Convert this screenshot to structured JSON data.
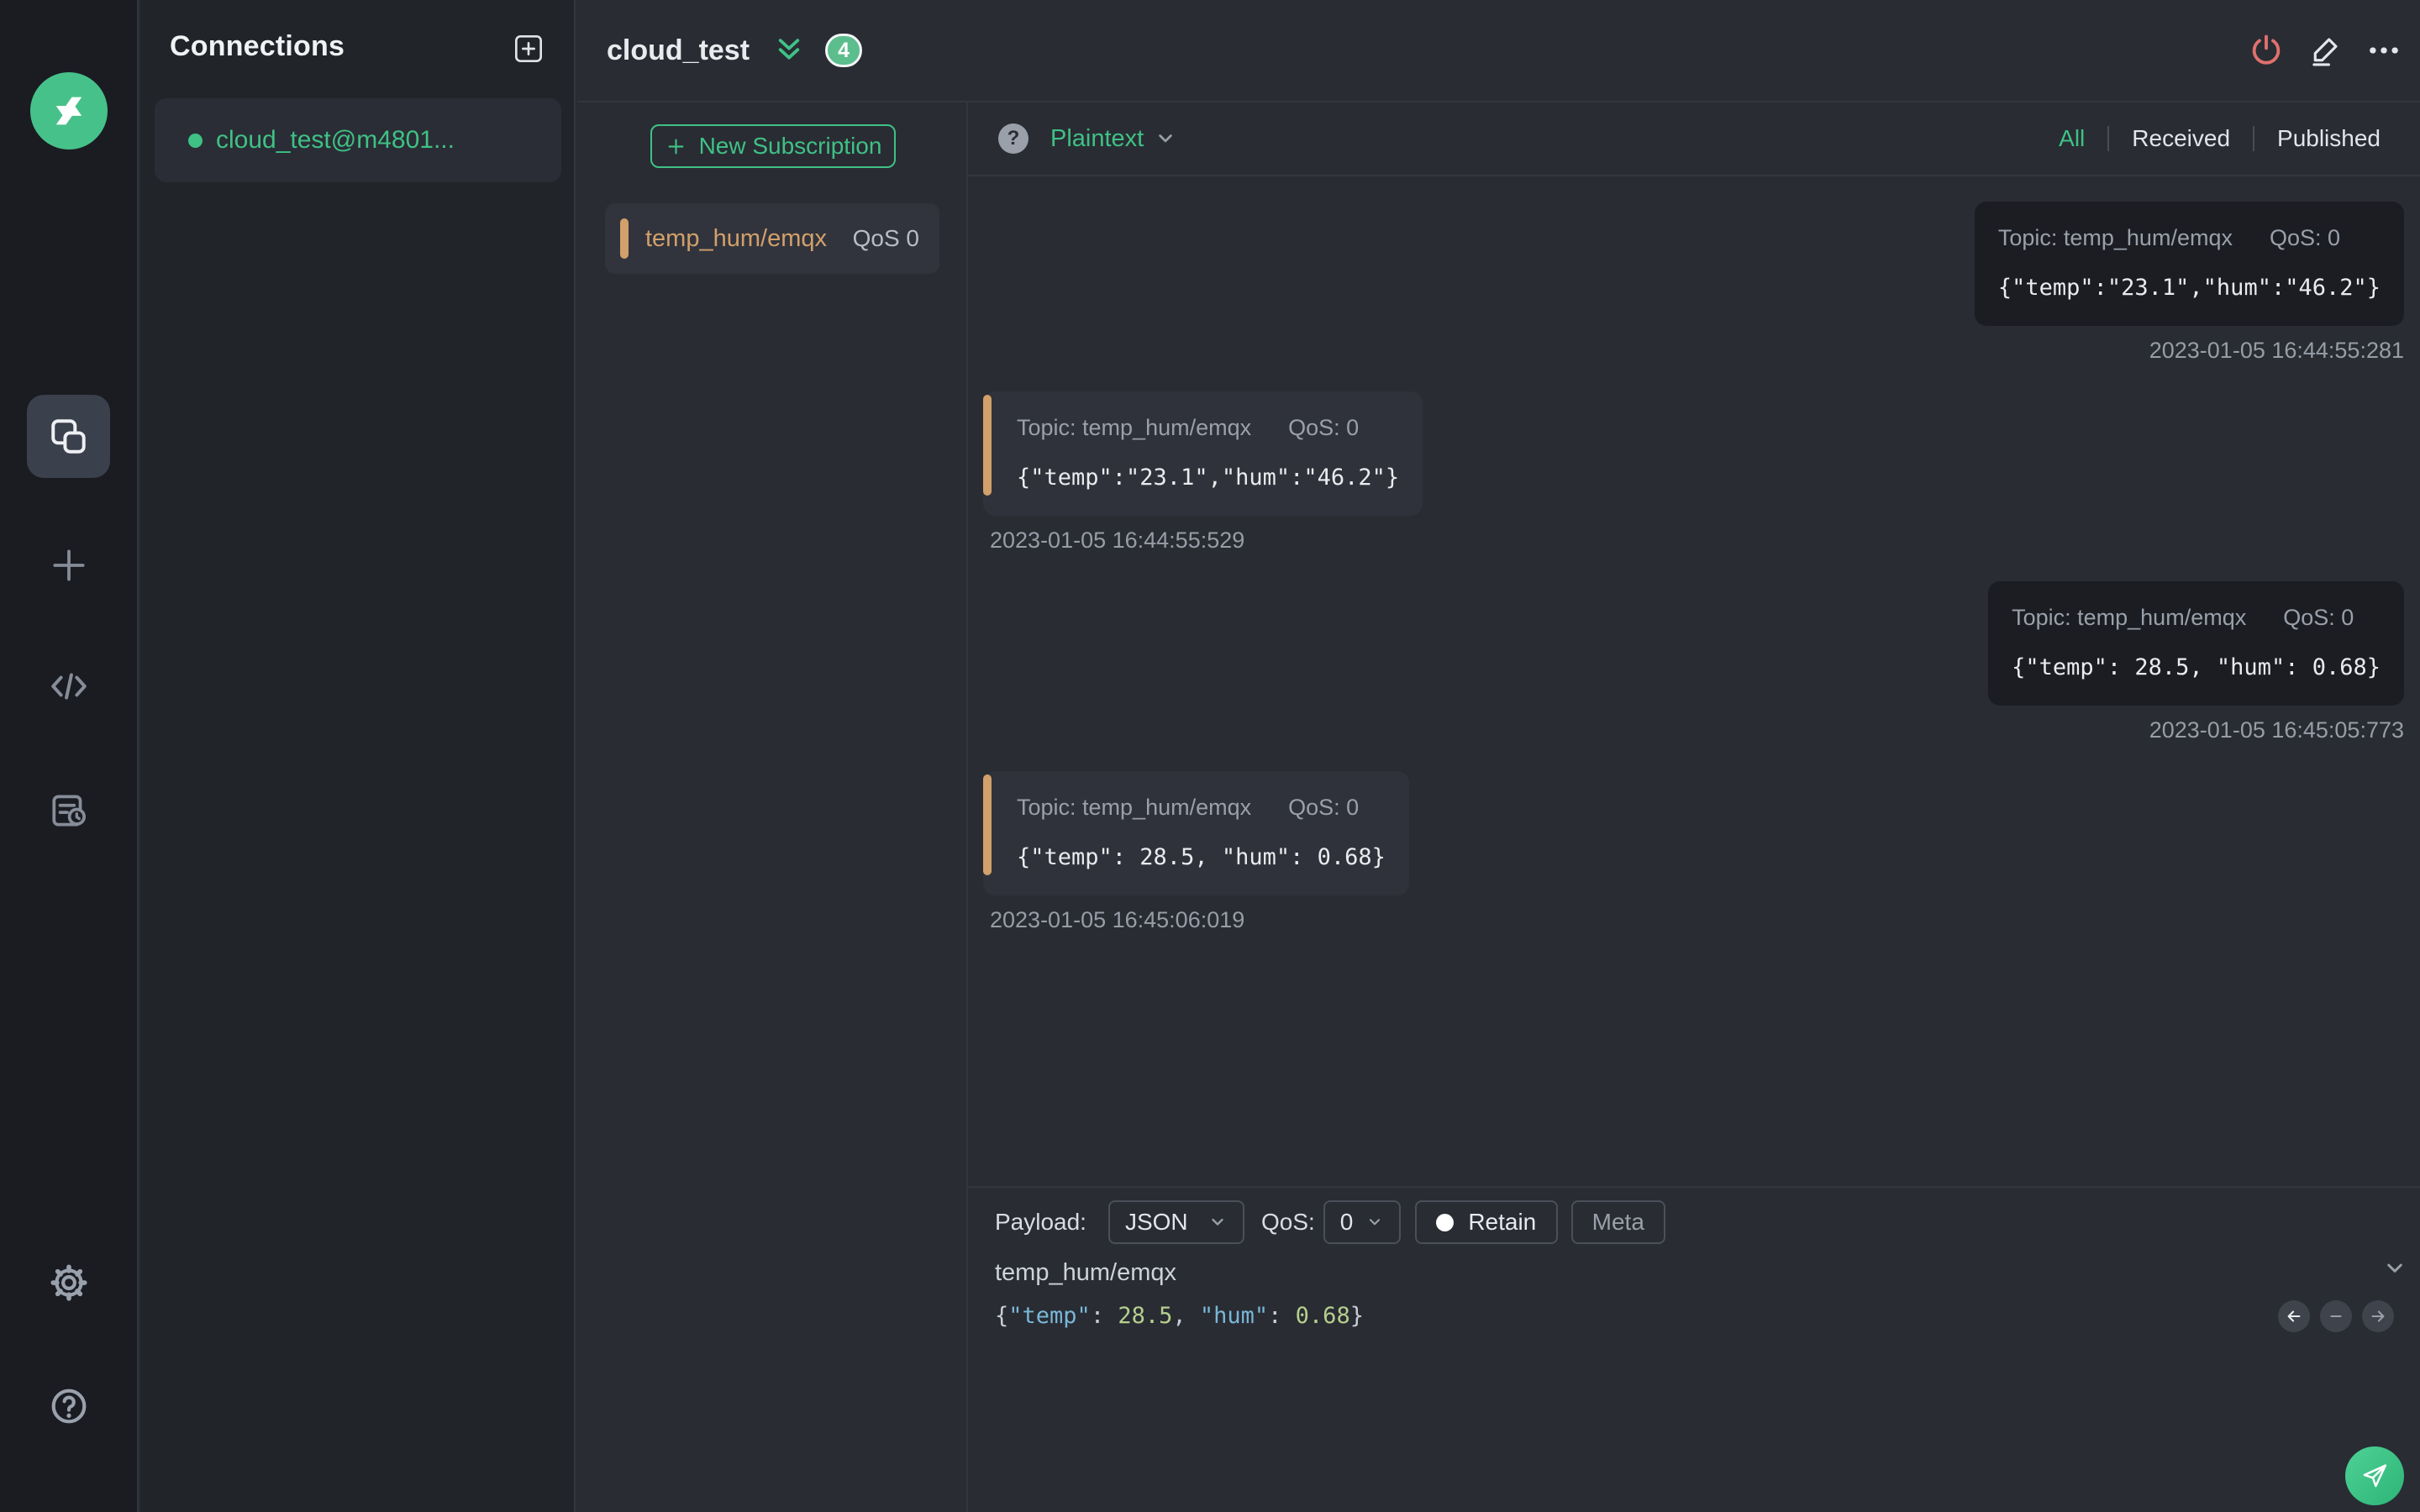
{
  "colors": {
    "accent_green": "#3fc185",
    "topic_orange": "#d2a06a",
    "disconnect_red": "#e0716f",
    "badge_green": "#5cbd8d"
  },
  "connections_panel": {
    "title": "Connections",
    "items": [
      {
        "label": "cloud_test@m4801...",
        "status": "connected"
      }
    ]
  },
  "header": {
    "title": "cloud_test",
    "badge_count": "4"
  },
  "subscriptions": {
    "new_button_label": "New Subscription",
    "items": [
      {
        "topic": "temp_hum/emqx",
        "qos": "QoS 0"
      }
    ]
  },
  "messages": {
    "format": "Plaintext",
    "tabs": [
      {
        "label": "All",
        "active": true
      },
      {
        "label": "Received",
        "active": false
      },
      {
        "label": "Published",
        "active": false
      }
    ],
    "items": [
      {
        "direction": "published",
        "topic": "Topic: temp_hum/emqx",
        "qos": "QoS: 0",
        "payload": "{\"temp\":\"23.1\",\"hum\":\"46.2\"}",
        "timestamp": "2023-01-05 16:44:55:281"
      },
      {
        "direction": "received",
        "topic": "Topic: temp_hum/emqx",
        "qos": "QoS: 0",
        "payload": "{\"temp\":\"23.1\",\"hum\":\"46.2\"}",
        "timestamp": "2023-01-05 16:44:55:529"
      },
      {
        "direction": "published",
        "topic": "Topic: temp_hum/emqx",
        "qos": "QoS: 0",
        "payload": "{\"temp\": 28.5, \"hum\": 0.68}",
        "timestamp": "2023-01-05 16:45:05:773"
      },
      {
        "direction": "received",
        "topic": "Topic: temp_hum/emqx",
        "qos": "QoS: 0",
        "payload": "{\"temp\": 28.5, \"hum\": 0.68}",
        "timestamp": "2023-01-05 16:45:06:019"
      }
    ]
  },
  "publish": {
    "payload_label": "Payload:",
    "format_value": "JSON",
    "qos_label": "QoS:",
    "qos_value": "0",
    "retain_label": "Retain",
    "meta_label": "Meta",
    "topic_value": "temp_hum/emqx",
    "payload_tokens": [
      {
        "text": "{",
        "type": "punct"
      },
      {
        "text": "\"temp\"",
        "type": "key"
      },
      {
        "text": ": ",
        "type": "punct"
      },
      {
        "text": "28.5",
        "type": "num"
      },
      {
        "text": ", ",
        "type": "punct"
      },
      {
        "text": "\"hum\"",
        "type": "key"
      },
      {
        "text": ": ",
        "type": "punct"
      },
      {
        "text": "0.68",
        "type": "num"
      },
      {
        "text": "}",
        "type": "punct"
      }
    ]
  },
  "icons": {
    "help_glyph": "?",
    "names": [
      "mqttx-logo",
      "connections-icon",
      "new-connection-icon",
      "script-icon",
      "log-icon",
      "settings-icon",
      "help-icon",
      "add-connection-icon",
      "disconnect-power-icon",
      "edit-pencil-icon",
      "more-ellipsis-icon",
      "payload-format-help-icon",
      "chevron-down-icon",
      "double-chevron-down-icon",
      "history-back-icon",
      "history-remove-icon",
      "history-forward-icon",
      "collapse-editor-icon",
      "send-icon",
      "retain-dot",
      "connected-dot",
      "subscription-accent-bar"
    ]
  }
}
